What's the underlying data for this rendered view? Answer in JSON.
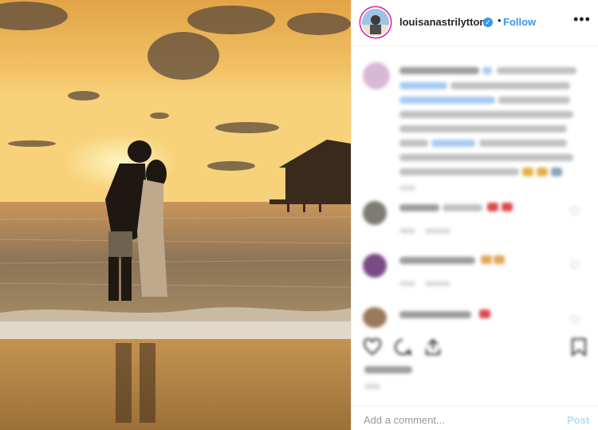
{
  "post": {
    "username": "louisanastrilytton",
    "follow_label": "Follow",
    "separator": "•",
    "more_label": "•••",
    "verified_mark": "✓"
  },
  "comment_box": {
    "placeholder": "Add a comment...",
    "post_label": "Post"
  },
  "icons": [
    "verified-badge-icon",
    "more-options-icon",
    "heart-icon",
    "comment-icon",
    "share-icon",
    "bookmark-icon"
  ],
  "colors": {
    "accent": "#3897f0",
    "post_button_disabled": "#b2dffc",
    "text": "#262626",
    "placeholder": "#999999"
  }
}
